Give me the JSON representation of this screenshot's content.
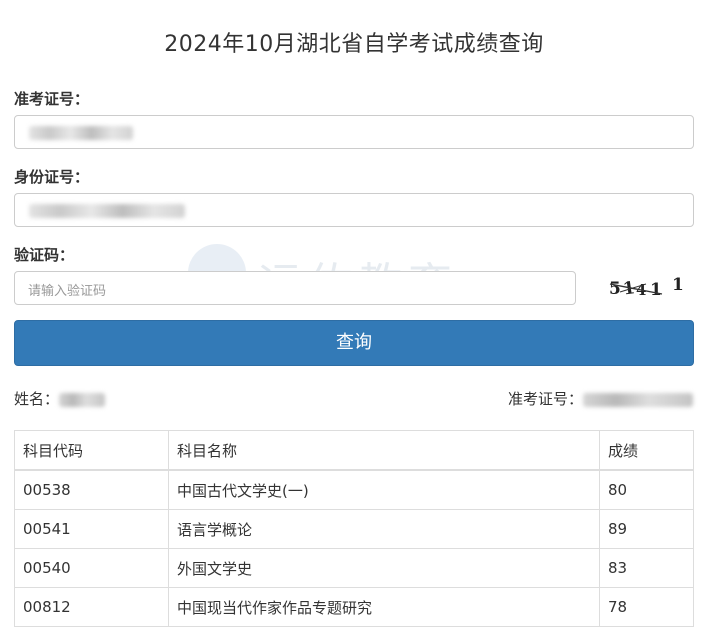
{
  "page": {
    "title": "2024年10月湖北省自学考试成绩查询"
  },
  "form": {
    "exam_id_label": "准考证号：",
    "id_card_label": "身份证号：",
    "captcha_label": "验证码：",
    "captcha_placeholder": "请输入验证码",
    "captcha_image_text": "5 1 4 1 1",
    "query_button": "查询"
  },
  "watermark": {
    "text": "远佑教育"
  },
  "result": {
    "name_label": "姓名：",
    "exam_id_label": "准考证号："
  },
  "table": {
    "headers": [
      "科目代码",
      "科目名称",
      "成绩"
    ],
    "rows": [
      {
        "code": "00538",
        "name": "中国古代文学史(一)",
        "score": "80"
      },
      {
        "code": "00541",
        "name": "语言学概论",
        "score": "89"
      },
      {
        "code": "00540",
        "name": "外国文学史",
        "score": "83"
      },
      {
        "code": "00812",
        "name": "中国现当代作家作品专题研究",
        "score": "78"
      }
    ]
  },
  "colors": {
    "primary_button": "#337ab7",
    "border": "#cccccc",
    "table_border": "#dddddd"
  }
}
